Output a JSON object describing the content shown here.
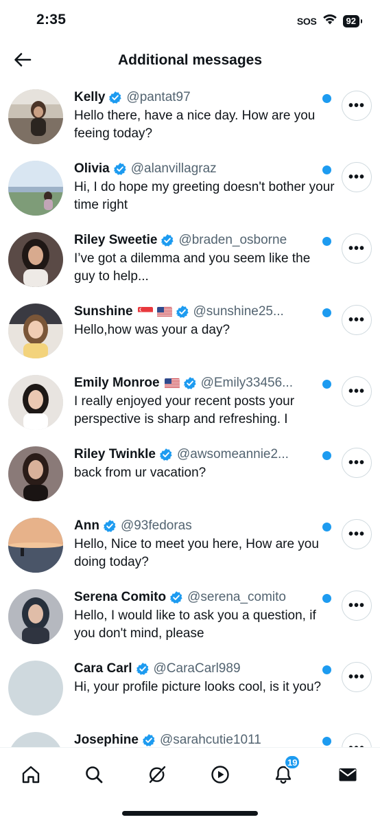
{
  "status_bar": {
    "time": "2:35",
    "sos": "SOS",
    "battery": "92"
  },
  "header": {
    "title": "Additional messages",
    "back_icon": "arrow-left-icon"
  },
  "messages": [
    {
      "name": "Kelly",
      "handle": "@pantat97",
      "text": "Hello there, have a nice day. How are you feeing today?",
      "verified": true,
      "unread": true
    },
    {
      "name": "Olivia",
      "handle": "@alanvillagraz",
      "text": "Hi, I do hope my greeting doesn't bother your time right",
      "verified": true,
      "unread": true
    },
    {
      "name": "Riley Sweetie",
      "handle": "@braden_osborne",
      "text": "I’ve got a dilemma and you seem like the guy to help...",
      "verified": true,
      "unread": true
    },
    {
      "name": "Sunshine",
      "flags": [
        "singapore-flag",
        "usa-flag"
      ],
      "handle": "@sunshine25...",
      "text": "Hello,how was your a day?",
      "verified": true,
      "unread": true
    },
    {
      "name": "Emily Monroe",
      "flags": [
        "usa-flag"
      ],
      "handle": "@Emily33456...",
      "text": "I really enjoyed your recent posts your perspective is sharp and refreshing. I",
      "verified": true,
      "unread": true
    },
    {
      "name": "Riley Twinkle",
      "handle": "@awsomeannie2...",
      "text": "back from ur vacation?",
      "verified": true,
      "unread": true
    },
    {
      "name": "Ann",
      "handle": "@93fedoras",
      "text": "Hello, Nice to meet you here, How are you doing today?",
      "verified": true,
      "unread": true
    },
    {
      "name": "Serena Comito",
      "handle": "@serena_comito",
      "text": "Hello, I would like to ask you a question, if you don't mind, please",
      "verified": true,
      "unread": true
    },
    {
      "name": "Cara Carl",
      "handle": "@CaraCarl989",
      "text": "Hi, your profile picture looks cool, is it you?",
      "verified": true,
      "unread": true
    },
    {
      "name": "Josephine",
      "handle": "@sarahcutie1011",
      "text": "",
      "verified": true,
      "unread": true
    }
  ],
  "more_button_label": "•••",
  "tab_bar": {
    "tabs": [
      "home-icon",
      "search-icon",
      "grok-icon",
      "play-icon",
      "bell-icon",
      "mail-icon"
    ],
    "notifications_badge": "19"
  },
  "colors": {
    "accent": "#1d9bf0",
    "text": "#0f1419",
    "secondary": "#536471",
    "border": "#cfd9de"
  }
}
